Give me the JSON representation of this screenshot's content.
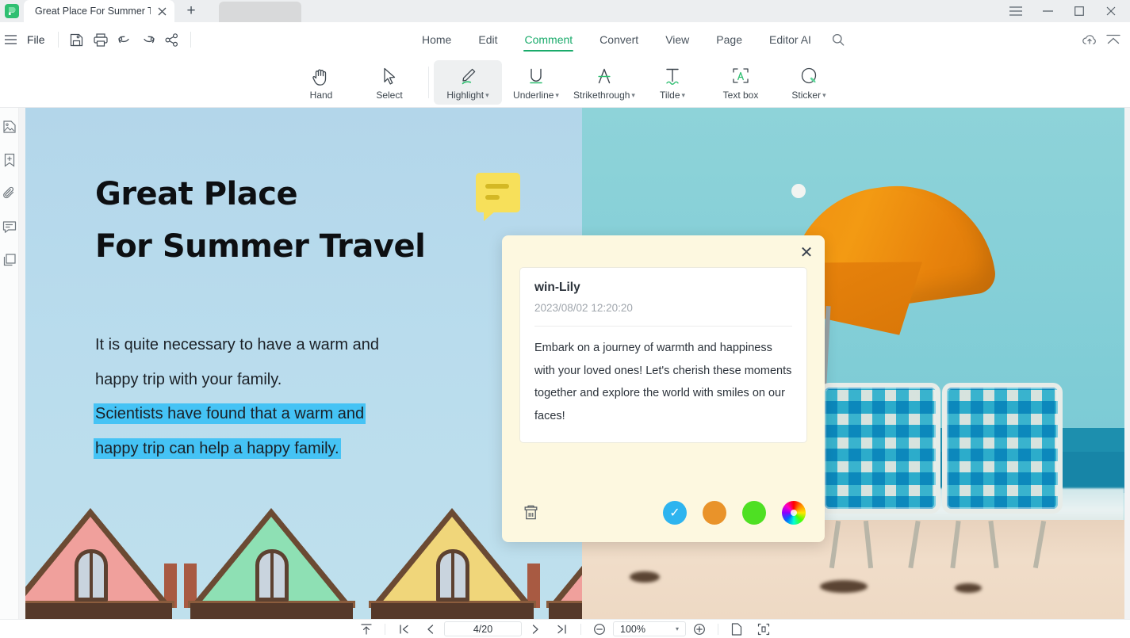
{
  "window": {
    "tab_title": "Great Place For Summer T...",
    "new_tab_label": "+",
    "controls": {
      "menu": "menu-hamburger",
      "minimize": "—",
      "maximize": "□",
      "close": "✕"
    }
  },
  "menubar": {
    "file_label": "File",
    "quick_icons": [
      "save-icon",
      "print-icon",
      "undo-icon",
      "redo-icon",
      "share-icon"
    ],
    "nav": [
      {
        "label": "Home",
        "active": false
      },
      {
        "label": "Edit",
        "active": false
      },
      {
        "label": "Comment",
        "active": true
      },
      {
        "label": "Convert",
        "active": false
      },
      {
        "label": "View",
        "active": false
      },
      {
        "label": "Page",
        "active": false
      },
      {
        "label": "Editor AI",
        "active": false
      }
    ],
    "search_icon": "search-icon",
    "right_icons": [
      "cloud-upload-icon",
      "collapse-ribbon-icon"
    ]
  },
  "ribbon": {
    "tools": [
      {
        "label": "Hand",
        "caret": false,
        "selected": false
      },
      {
        "label": "Select",
        "caret": false,
        "selected": false
      },
      {
        "label": "Highlight",
        "caret": true,
        "selected": true
      },
      {
        "label": "Underline",
        "caret": true,
        "selected": false
      },
      {
        "label": "Strikethrough",
        "caret": true,
        "selected": false
      },
      {
        "label": "Tilde",
        "caret": true,
        "selected": false
      },
      {
        "label": "Text box",
        "caret": false,
        "selected": false
      },
      {
        "label": "Sticker",
        "caret": true,
        "selected": false
      }
    ]
  },
  "left_rail": {
    "items": [
      "thumbnail-icon",
      "bookmark-add-icon",
      "attachment-icon",
      "comment-icon",
      "layers-icon"
    ]
  },
  "document": {
    "heading_line1": "Great Place",
    "heading_line2": "For Summer Travel",
    "para_line1": "It is quite necessary to have a warm and",
    "para_line2": "happy trip with your family.",
    "para_line3_highlight": "Scientists have found that a warm and",
    "para_line4_highlight": "happy trip can help a happy family.",
    "highlight_color": "#45c3f5",
    "marker_color": "#f7e05a"
  },
  "comment_popup": {
    "close_label": "✕",
    "author": "win-Lily",
    "timestamp": "2023/08/02 12:20:20",
    "body": "Embark on a journey of warmth and happiness with your loved ones! Let's cherish these moments together and explore the world with smiles on our faces!",
    "delete_icon": "trash-icon",
    "colors": [
      {
        "name": "blue",
        "hex": "#2eb4ef",
        "selected": true
      },
      {
        "name": "orange",
        "hex": "#e9932a",
        "selected": false
      },
      {
        "name": "green",
        "hex": "#4ee023",
        "selected": false
      },
      {
        "name": "color-wheel",
        "hex": "rainbow",
        "selected": false
      }
    ],
    "check_glyph": "✓"
  },
  "statusbar": {
    "fit_icon": "fit-page-icon",
    "first_page_icon": "first-page-icon",
    "prev_page_icon": "prev-page-icon",
    "page_value": "4/20",
    "next_page_icon": "next-page-icon",
    "last_page_icon": "last-page-icon",
    "zoom_out_icon": "zoom-out-icon",
    "zoom_value": "100%",
    "zoom_caret": "▾",
    "zoom_in_icon": "zoom-in-icon",
    "single_page_icon": "single-page-view-icon",
    "fit_width_icon": "fit-width-icon"
  },
  "theme": {
    "accent": "#1aab6b",
    "tab_bar_bg": "#eceef0",
    "popup_bg": "#fdf8e0",
    "page_bg": "#b9d9ec"
  }
}
